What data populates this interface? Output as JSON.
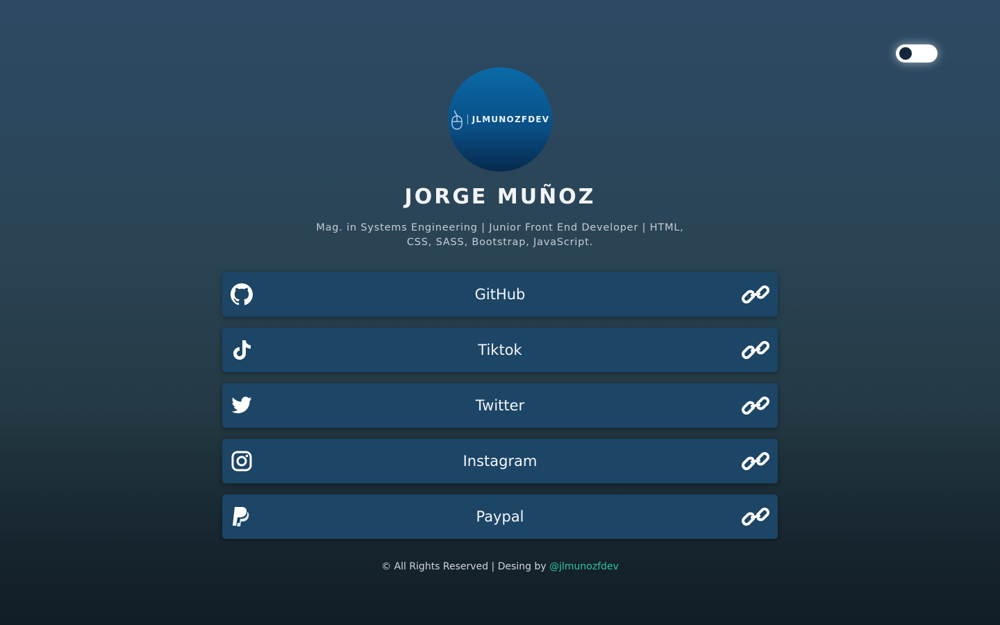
{
  "theme_toggle": {
    "state": "off"
  },
  "profile": {
    "logo_text": "JLMUNOZFDEV",
    "name": "JORGE MUÑOZ",
    "bio": "Mag. in Systems Engineering | Junior Front End Developer | HTML, CSS, SASS, Bootstrap, JavaScript."
  },
  "links": [
    {
      "label": "GitHub",
      "icon": "github-icon"
    },
    {
      "label": "Tiktok",
      "icon": "tiktok-icon"
    },
    {
      "label": "Twitter",
      "icon": "twitter-icon"
    },
    {
      "label": "Instagram",
      "icon": "instagram-icon"
    },
    {
      "label": "Paypal",
      "icon": "paypal-icon"
    }
  ],
  "footer": {
    "text": "© All Rights Reserved | Desing by ",
    "handle": "@jlmunozfdev"
  },
  "colors": {
    "card": "#1c4566",
    "accent": "#2ec4a0"
  }
}
